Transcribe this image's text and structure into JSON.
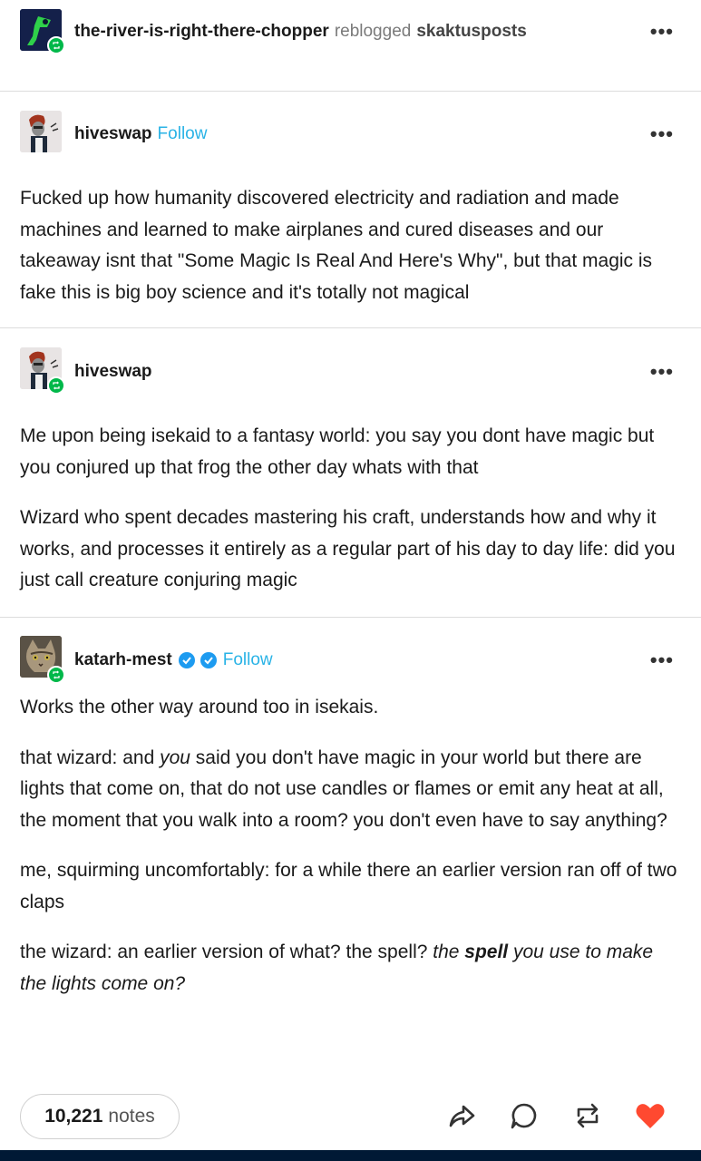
{
  "reblog_header": {
    "user": "the-river-is-right-there-chopper",
    "action": "reblogged",
    "source": "skaktusposts"
  },
  "posts": [
    {
      "user": "hiveswap",
      "follow": "Follow",
      "paragraphs": [
        "Fucked up how humanity discovered electricity and radiation and made machines and learned to make airplanes and cured diseases and our takeaway isnt that \"Some Magic Is Real And Here's Why\", but that magic is fake this is big boy science and it's totally not magical"
      ]
    },
    {
      "user": "hiveswap",
      "paragraphs": [
        "Me upon being isekaid to a fantasy world: you say you dont have magic but you conjured up that frog the other day whats with that",
        "Wizard who spent decades mastering his craft, understands how and why it works, and processes it entirely as a regular part of his day to day life: did you just call creature conjuring magic"
      ]
    },
    {
      "user": "katarh-mest",
      "follow": "Follow",
      "paragraphs": [
        "Works the other way around too in isekais.",
        {
          "p1_a": "that wizard:  and ",
          "p1_em": "you",
          "p1_b": " said you don't have magic in your world but there are lights that come on, that do not use candles or flames or emit any heat at all, the moment that you walk into a room? you don't even have to say anything?"
        },
        "me, squirming uncomfortably: for a while there an earlier version ran off of two claps",
        {
          "p4_a": "the wizard:  an earlier version of what?  the spell?  ",
          "p4_em1": "the ",
          "p4_strong": "spell",
          "p4_em2": " you use to make the lights come on?"
        }
      ]
    }
  ],
  "footer": {
    "notes_count": "10,221",
    "notes_label": "notes"
  },
  "colors": {
    "follow": "#2ab3e6",
    "reblog_badge": "#00b84a",
    "like_heart": "#ff4930",
    "bottom_bar": "#001935"
  },
  "icons": [
    "share-icon",
    "reply-icon",
    "reblog-icon",
    "like-heart-icon",
    "more-options-icon",
    "verified-badge-icon",
    "reblog-badge-icon"
  ]
}
